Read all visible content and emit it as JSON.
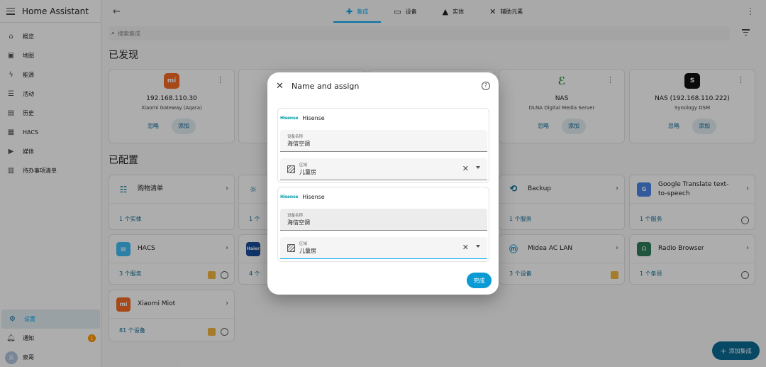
{
  "app": {
    "title": "Home Assistant"
  },
  "sidebar": {
    "items": [
      {
        "label": "概览",
        "icon": "home-icon"
      },
      {
        "label": "地图",
        "icon": "map-icon"
      },
      {
        "label": "能源",
        "icon": "lightning-icon"
      },
      {
        "label": "活动",
        "icon": "list-icon"
      },
      {
        "label": "历史",
        "icon": "chart-icon"
      },
      {
        "label": "HACS",
        "icon": "hacs-icon"
      },
      {
        "label": "媒体",
        "icon": "media-icon"
      },
      {
        "label": "待办事项清单",
        "icon": "clipboard-icon"
      }
    ],
    "settings_label": "设置",
    "notifications_label": "通知",
    "notifications_count": "1",
    "user_label": "泉哥",
    "user_initial": "泉"
  },
  "tabs": [
    {
      "label": "集成",
      "icon": "puzzle-icon",
      "active": true
    },
    {
      "label": "设备",
      "icon": "devices-icon",
      "active": false
    },
    {
      "label": "实体",
      "icon": "shapes-icon",
      "active": false
    },
    {
      "label": "辅助元素",
      "icon": "tools-icon",
      "active": false
    }
  ],
  "search": {
    "placeholder": "搜索集成"
  },
  "discovered": {
    "title": "已发现",
    "cards": [
      {
        "name": "192.168.110.30",
        "sub": "Xiaomi Gateway (Aqara)",
        "ignore": "忽略",
        "add": "添加",
        "logo_color": "#f56a23",
        "logo_text": "mi"
      },
      {
        "name": "NAS",
        "sub": "DLNA Digital Media Server",
        "ignore": "忽略",
        "add": "添加",
        "logo_color": "#ffffff",
        "logo_text": ""
      },
      {
        "name": "NAS (192.168.110.222)",
        "sub": "Synology DSM",
        "ignore": "忽略",
        "add": "添加",
        "logo_color": "#111111",
        "logo_text": "S"
      }
    ]
  },
  "configured": {
    "title": "已配置",
    "cards": [
      {
        "name": "购物清单",
        "link": "1 个实体"
      },
      {
        "name": "",
        "link": "1 个"
      },
      {
        "name": "Backup",
        "link": "1 个服务"
      },
      {
        "name": "Google Translate text-to-speech",
        "link": "1 个服务"
      },
      {
        "name": "HACS",
        "link": "3 个服务"
      },
      {
        "name": "",
        "link": "4 个"
      },
      {
        "name": "Midea AC LAN",
        "link": "3 个设备"
      },
      {
        "name": "Radio Browser",
        "link": "1 个条目"
      },
      {
        "name": "Xiaomi Miot",
        "link": "81 个设备"
      }
    ]
  },
  "fab": {
    "label": "添加集成"
  },
  "dialog": {
    "title": "Name and assign",
    "devices": [
      {
        "brand": "Hisense",
        "brand_logo": "Hisense",
        "name_label": "设备名称",
        "name_value": "海信空调",
        "area_label": "区域",
        "area_value": "儿童房"
      },
      {
        "brand": "Hisense",
        "brand_logo": "Hisense",
        "name_label": "设备名称",
        "name_value": "海信空调",
        "area_label": "区域",
        "area_value": "儿童房"
      }
    ],
    "done_label": "完成"
  },
  "colors": {
    "accent": "#03a9f4",
    "primary": "#0b6b96",
    "warning": "#ff9800"
  }
}
